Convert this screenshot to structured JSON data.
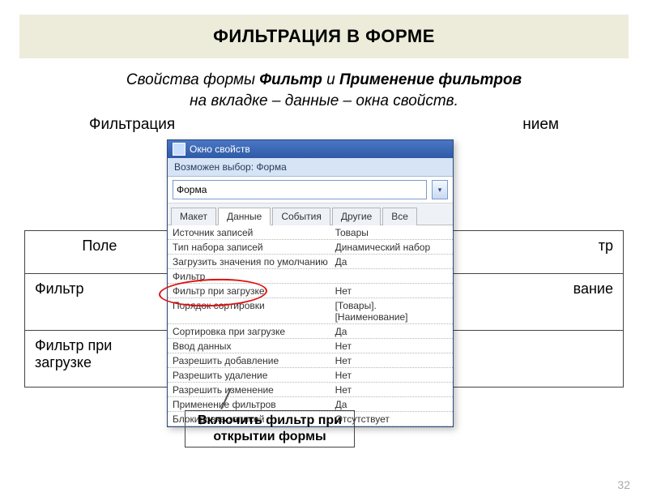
{
  "title": "ФИЛЬТРАЦИЯ В ФОРМЕ",
  "intro": {
    "line1_plain": "Свойства формы ",
    "line1_b1": "Фильтр",
    "line1_mid": " и ",
    "line1_b2": "Применение фильтров",
    "line2": "на вкладке – данные – окна свойств.",
    "line3_left": "Фильтрация",
    "line3_right": "нием"
  },
  "bg_table": {
    "h1": "Поле",
    "h2": "тр",
    "r1c1": "Фильтр",
    "r1c2": "вание",
    "r2c1": "Фильтр при загрузке",
    "r2c2": ""
  },
  "window": {
    "title": "Окно свойств",
    "section": "Возможен выбор:  Форма",
    "type_value": "Форма",
    "tabs": [
      "Макет",
      "Данные",
      "События",
      "Другие",
      "Все"
    ],
    "active_tab": 1,
    "props": [
      {
        "k": "Источник записей",
        "v": "Товары"
      },
      {
        "k": "Тип набора записей",
        "v": "Динамический набор"
      },
      {
        "k": "Загрузить значения по умолчанию",
        "v": "Да"
      },
      {
        "k": "Фильтр",
        "v": ""
      },
      {
        "k": "Фильтр при загрузке",
        "v": "Нет"
      },
      {
        "k": "Порядок сортировки",
        "v": "[Товары].[Наименование]"
      },
      {
        "k": "Сортировка при загрузке",
        "v": "Да"
      },
      {
        "k": "Ввод данных",
        "v": "Нет"
      },
      {
        "k": "Разрешить добавление",
        "v": "Нет"
      },
      {
        "k": "Разрешить удаление",
        "v": "Нет"
      },
      {
        "k": "Разрешить изменение",
        "v": "Нет"
      },
      {
        "k": "Применение фильтров",
        "v": "Да"
      },
      {
        "k": "Блокировка записей",
        "v": "Отсутствует"
      }
    ]
  },
  "callout": "Включить фильтр при открытии формы",
  "page": "32"
}
